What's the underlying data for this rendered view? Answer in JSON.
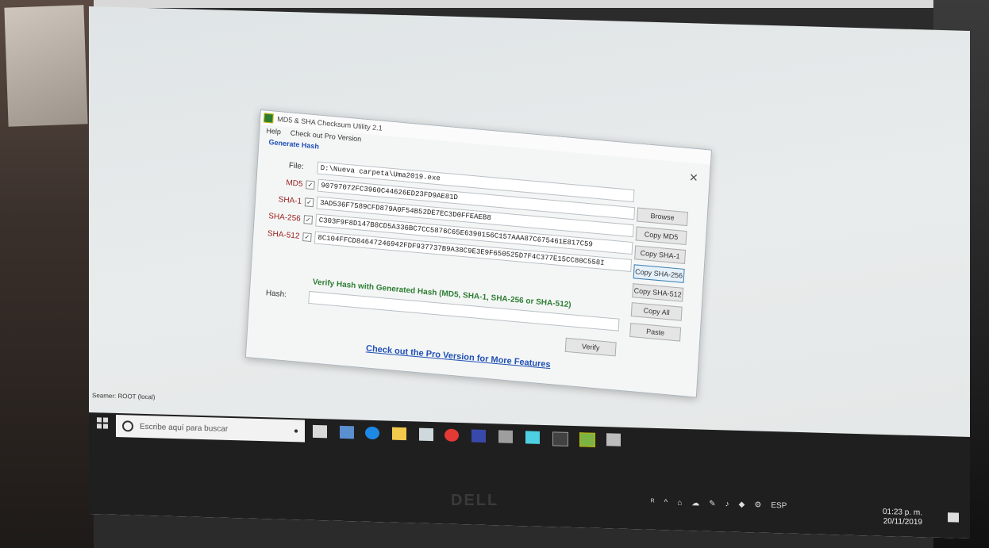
{
  "window": {
    "title": "MD5 & SHA Checksum Utility 2.1",
    "close_glyph": "✕"
  },
  "menu": {
    "help": "Help",
    "pro": "Check out Pro Version"
  },
  "generate": {
    "section_title": "Generate Hash",
    "file_label": "File:",
    "file_path": "D:\\Nueva carpeta\\Uma2019.exe",
    "md5_label": "MD5",
    "md5_value": "90797072FC3960C44626ED23FD9AE81D",
    "sha1_label": "SHA-1",
    "sha1_value": "3AD536F7589CFD879A0F54B52DE7EC3D0FFEAEB8",
    "sha256_label": "SHA-256",
    "sha256_value": "C303F9F8D147B8CD5A336BC7CC5876C65E6390156C157AAA87C675461E817C59",
    "sha512_label": "SHA-512",
    "sha512_value": "8C104FFCD84647246942FDF937737B9A38C9E3E9F650525D7F4C377E15CC80C558I",
    "check_glyph": "✓"
  },
  "buttons": {
    "browse": "Browse",
    "copy_md5": "Copy MD5",
    "copy_sha1": "Copy SHA-1",
    "copy_sha256": "Copy SHA-256",
    "copy_sha512": "Copy SHA-512",
    "copy_all": "Copy All",
    "paste": "Paste",
    "verify": "Verify"
  },
  "verify": {
    "title": "Verify Hash with Generated Hash (MD5, SHA-1, SHA-256 or SHA-512)",
    "hash_label": "Hash:",
    "hash_value": ""
  },
  "link": {
    "pro_features": "Check out the Pro Version for More Features"
  },
  "desktop": {
    "corner_label": "Seamer: ROOT (local)"
  },
  "taskbar": {
    "search_placeholder": "Escribe aquí para buscar",
    "language": "ESP",
    "time": "01:23 p. m.",
    "date": "20/11/2019"
  },
  "bezel": {
    "brand": "DELL"
  },
  "colors": {
    "accent_link": "#1f4fb5",
    "verify_green": "#2e7d32",
    "label_red": "#9c1b1b",
    "taskbar": "#1f1f1f"
  }
}
